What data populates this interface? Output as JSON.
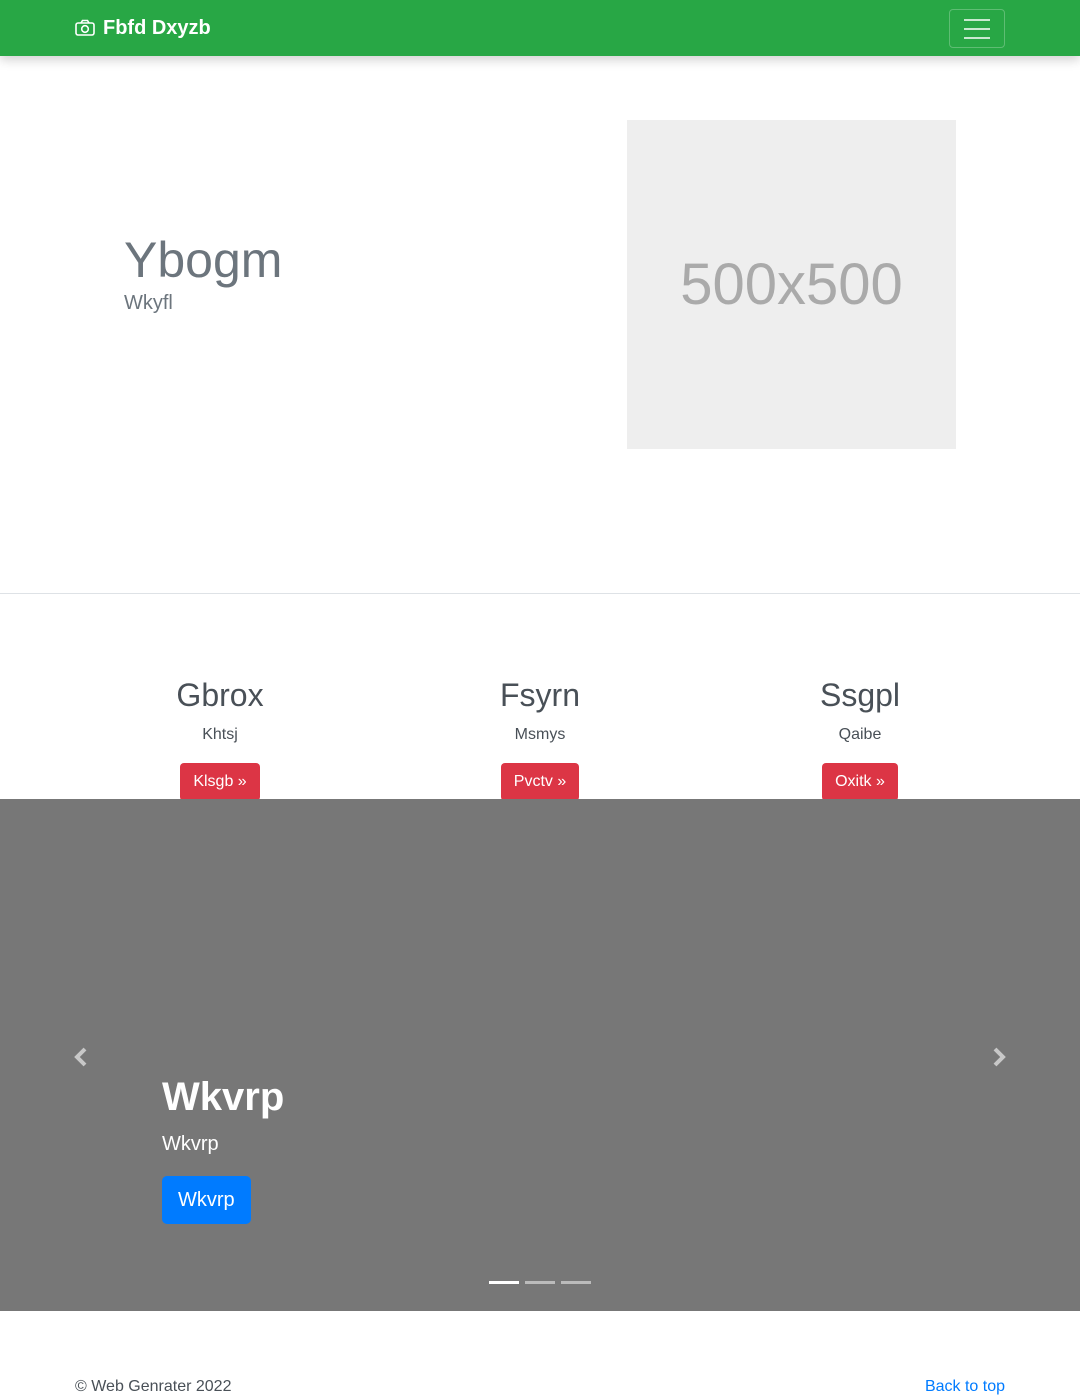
{
  "navbar": {
    "brand": "Fbfd Dxyzb",
    "brand_icon": "camera-icon",
    "toggler_icon": "hamburger-icon",
    "color": "#28a745"
  },
  "hero": {
    "title": "Ybogm",
    "subtitle": "Wkyfl",
    "image_placeholder": "500x500"
  },
  "features": [
    {
      "title": "Gbrox",
      "text": "Khtsj",
      "button": "Klsgb »"
    },
    {
      "title": "Fsyrn",
      "text": "Msmys",
      "button": "Pvctv »"
    },
    {
      "title": "Ssgpl",
      "text": "Qaibe",
      "button": "Oxitk »"
    }
  ],
  "carousel": {
    "title": "Wkvrp",
    "subtitle": "Wkvrp",
    "button": "Wkvrp",
    "prev_icon": "chevron-left-icon",
    "next_icon": "chevron-right-icon",
    "active_slide": 1,
    "slide_count": 3
  },
  "footer": {
    "copyright": "© Web Genrater 2022",
    "back_to_top": "Back to top"
  }
}
